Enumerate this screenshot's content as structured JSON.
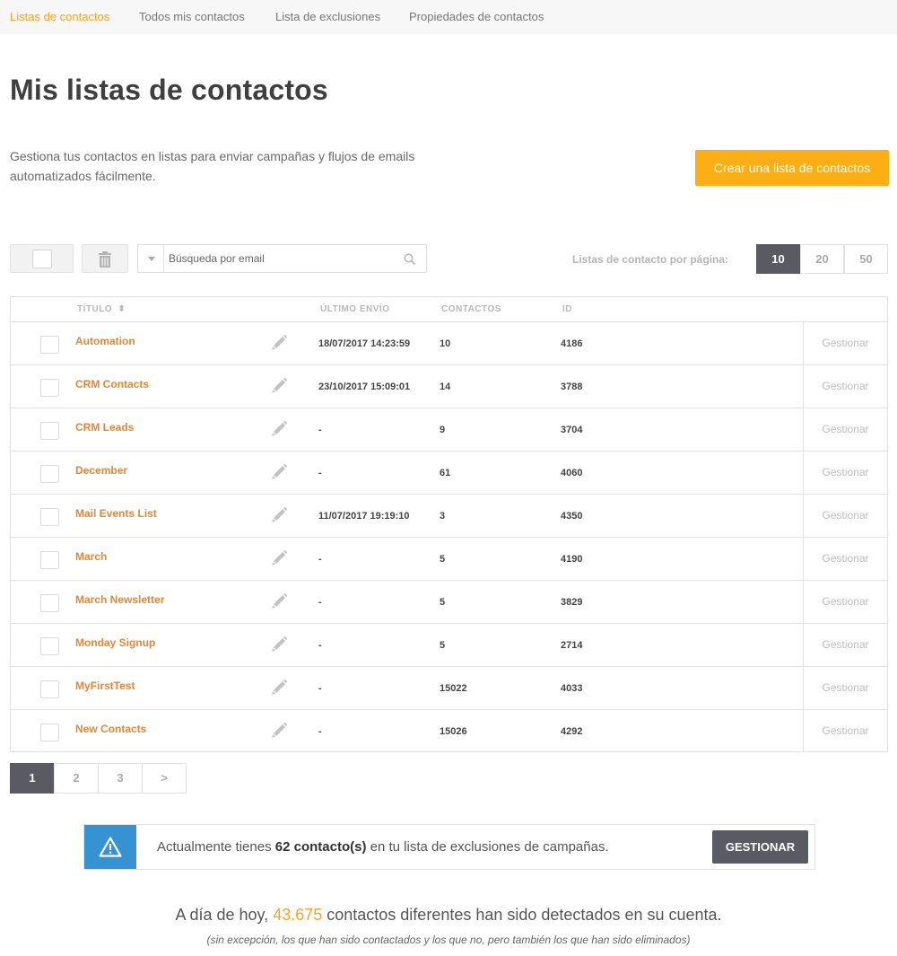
{
  "nav": {
    "tabs": [
      {
        "label": "Listas de contactos",
        "active": true
      },
      {
        "label": "Todos mis contactos",
        "active": false
      },
      {
        "label": "Lista de exclusiones",
        "active": false
      },
      {
        "label": "Propiedades de contactos",
        "active": false
      }
    ]
  },
  "header": {
    "title": "Mis listas de contactos",
    "description": "Gestiona tus contactos en listas para enviar campañas y flujos de emails automatizados fácilmente.",
    "create_button": "Crear una lista de contactos"
  },
  "toolbar": {
    "search_placeholder": "Búsqueda por email",
    "per_page_label": "Listas de contacto por página:",
    "per_page_options": [
      "10",
      "20",
      "50"
    ],
    "per_page_selected": "10"
  },
  "table": {
    "columns": {
      "title": "TÍTULO",
      "title_sort": "⬍",
      "last_send": "ÚLTIMO ENVÍO",
      "contacts": "CONTACTOS",
      "id": "ID"
    },
    "rows": [
      {
        "name": "Automation",
        "last_send": "18/07/2017 14:23:59",
        "contacts": "10",
        "id": "4186",
        "action": "Gestionar"
      },
      {
        "name": "CRM Contacts",
        "last_send": "23/10/2017 15:09:01",
        "contacts": "14",
        "id": "3788",
        "action": "Gestionar"
      },
      {
        "name": "CRM Leads",
        "last_send": "-",
        "contacts": "9",
        "id": "3704",
        "action": "Gestionar"
      },
      {
        "name": "December",
        "last_send": "-",
        "contacts": "61",
        "id": "4060",
        "action": "Gestionar"
      },
      {
        "name": "Mail Events List",
        "last_send": "11/07/2017 19:19:10",
        "contacts": "3",
        "id": "4350",
        "action": "Gestionar"
      },
      {
        "name": "March",
        "last_send": "-",
        "contacts": "5",
        "id": "4190",
        "action": "Gestionar"
      },
      {
        "name": "March Newsletter",
        "last_send": "-",
        "contacts": "5",
        "id": "3829",
        "action": "Gestionar"
      },
      {
        "name": "Monday Signup",
        "last_send": "-",
        "contacts": "5",
        "id": "2714",
        "action": "Gestionar"
      },
      {
        "name": "MyFirstTest",
        "last_send": "-",
        "contacts": "15022",
        "id": "4033",
        "action": "Gestionar"
      },
      {
        "name": "New Contacts",
        "last_send": "-",
        "contacts": "15026",
        "id": "4292",
        "action": "Gestionar"
      }
    ]
  },
  "pagination": {
    "pages": [
      "1",
      "2",
      "3",
      ">"
    ],
    "current": "1"
  },
  "alert": {
    "text_before": "Actualmente tienes ",
    "count": "62 contacto(s)",
    "text_after": " en tu lista de exclusiones de campañas.",
    "button": "GESTIONAR"
  },
  "summary": {
    "before": "A día de hoy, ",
    "count": "43.675",
    "after": " contactos diferentes han sido detectados en su cuenta.",
    "note": "(sin excepción, los que han sido contactados y los que no, pero también los que han sido eliminados)"
  },
  "colors": {
    "accent": "#fbaf14",
    "link": "#e0883a",
    "dark": "#595a62",
    "info": "#3592d3"
  },
  "icons": [
    "trash-icon",
    "caret-down-icon",
    "search-icon",
    "pencil-icon",
    "warning-icon",
    "sort-icon"
  ]
}
